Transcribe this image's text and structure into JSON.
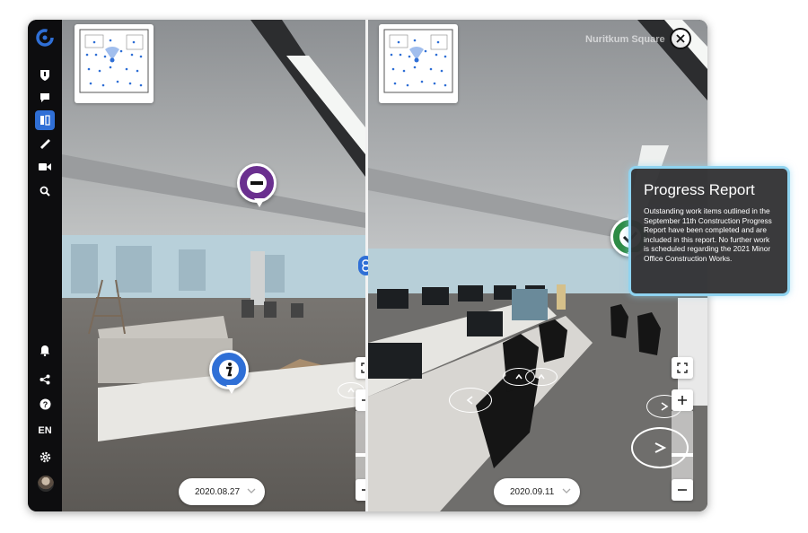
{
  "sidebar": {
    "items": [
      {
        "name": "shield-icon"
      },
      {
        "name": "comment-icon"
      },
      {
        "name": "compare-icon",
        "active": true
      },
      {
        "name": "ruler-icon"
      },
      {
        "name": "video-icon"
      },
      {
        "name": "search-icon"
      }
    ],
    "bottom": {
      "language": "EN"
    }
  },
  "left_pane": {
    "date": "2020.08.27",
    "markers": [
      {
        "type": "minus",
        "icon": "minus-icon",
        "color": "#6a2f8f"
      },
      {
        "type": "info",
        "icon": "info-icon",
        "color": "#2f6fd6"
      }
    ]
  },
  "right_pane": {
    "date": "2020.09.11",
    "watermark": "Nuritkum Square",
    "markers": [
      {
        "type": "check",
        "icon": "check-icon",
        "color": "#2e8b45"
      }
    ]
  },
  "report": {
    "title": "Progress Report",
    "body": "Outstanding work items outlined in the September 11th Construction Progress Report have been completed and are included in this report. No further work is scheduled regarding the 2021 Minor Office Construction Works."
  },
  "colors": {
    "accent": "#2f6fd6",
    "report_border": "#8fd3f0",
    "minus_marker": "#6a2f8f",
    "check_marker": "#2e8b45"
  }
}
